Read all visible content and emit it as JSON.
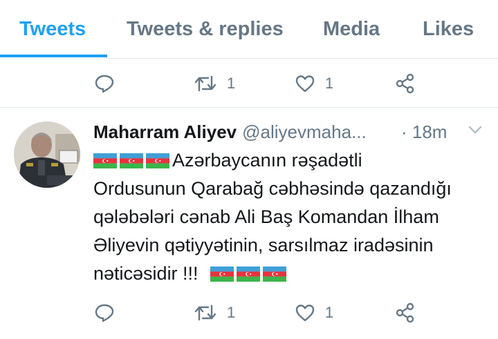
{
  "tabs": [
    {
      "label": "Tweets",
      "active": true
    },
    {
      "label": "Tweets & replies",
      "active": false
    },
    {
      "label": "Media",
      "active": false
    },
    {
      "label": "Likes",
      "active": false
    }
  ],
  "accent_color": "#1da1f2",
  "previous_tweet_actions": {
    "reply_icon": "reply-icon",
    "retweet_count": "1",
    "like_count": "1",
    "share_icon": "share-icon"
  },
  "tweet": {
    "author_name": "Maharram Aliyev",
    "author_handle": "@aliyevmaha...",
    "time": "· 18m",
    "text_line1": "Azərbaycanın rəşadətli",
    "text_line2": "Ordusunun Qarabağ cəbhəsində qazandığı",
    "text_line3": "qələbələri cənab Ali Baş Komandan İlham",
    "text_line4": "Əliyevin qətiyyətinin, sarsılmaz iradəsinin",
    "text_line5": "nəticəsidir !!!",
    "flag_icon": "azerbaijan-flag-icon",
    "retweet_count": "1",
    "like_count": "1"
  }
}
